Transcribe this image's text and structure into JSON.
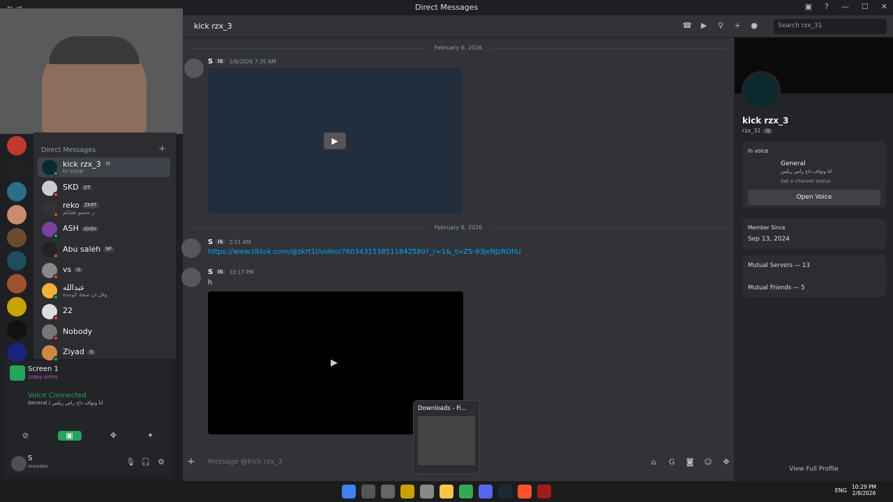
{
  "window": {
    "title": "Direct Messages"
  },
  "dm": {
    "header": "Direct Messages",
    "items": [
      {
        "name": "kick rzx_3",
        "tag": "iS",
        "sub": "In voice"
      },
      {
        "name": "SKD",
        "tag": "OT",
        "sub": ""
      },
      {
        "name": "reko",
        "tag": "ZKRT",
        "sub": "ز محمو نقتلكم"
      },
      {
        "name": "ASH",
        "tag": "zjoljo",
        "sub": ""
      },
      {
        "name": "Abu saleh",
        "tag": "NF",
        "sub": ""
      },
      {
        "name": "vs",
        "tag": "iS",
        "sub": ""
      },
      {
        "name": "عبدالله",
        "tag": "",
        "sub": "وقل ان صحة الوحدة"
      },
      {
        "name": "22",
        "tag": "",
        "sub": ""
      },
      {
        "name": "Nobody",
        "tag": "",
        "sub": ""
      },
      {
        "name": "Ziyad",
        "tag": "iS",
        "sub": ""
      }
    ]
  },
  "screen": {
    "title": "Screen 1",
    "sub": "1080p 60FPS"
  },
  "voice": {
    "status": "Voice Connected",
    "channel": "General / انا وتواف داج راس ريلس"
  },
  "user": {
    "name": "S",
    "status": "Invisible"
  },
  "chat": {
    "title": "kick rzx_3",
    "search_placeholder": "Search rzx_31",
    "date1": "February 6, 2026",
    "date2": "February 8, 2026",
    "msgs": [
      {
        "author": "S",
        "tag": "iS",
        "time": "2/6/2026 7:35 AM"
      },
      {
        "author": "S",
        "tag": "iS",
        "time": "2:51 AM",
        "link": "https://www.tiktok.com/@zkrt1i/video/7603431538511842580?_r=1&_t=ZS-93jeNJzRDhU"
      },
      {
        "author": "S",
        "tag": "iS",
        "time": "10:17 PM",
        "text": "h"
      }
    ],
    "input_placeholder": "Message @kick rzx_3",
    "popup": "Downloads - Fi..."
  },
  "profile": {
    "name": "kick rzx_3",
    "handle": "rzx_31",
    "tag": "iS",
    "in_voice": "In voice",
    "channel": "General",
    "channel_sub": "انا وتواف داج راس ريلس",
    "set_status": "Set a channel status",
    "open_voice": "Open Voice",
    "member_since_label": "Member Since",
    "member_since": "Sep 13, 2024",
    "servers": "Mutual Servers — 13",
    "friends": "Mutual Friends — 5",
    "view": "View Full Profile"
  },
  "taskbar": {
    "lang": "ENG",
    "time": "10:29 PM",
    "date": "2/8/2026"
  }
}
